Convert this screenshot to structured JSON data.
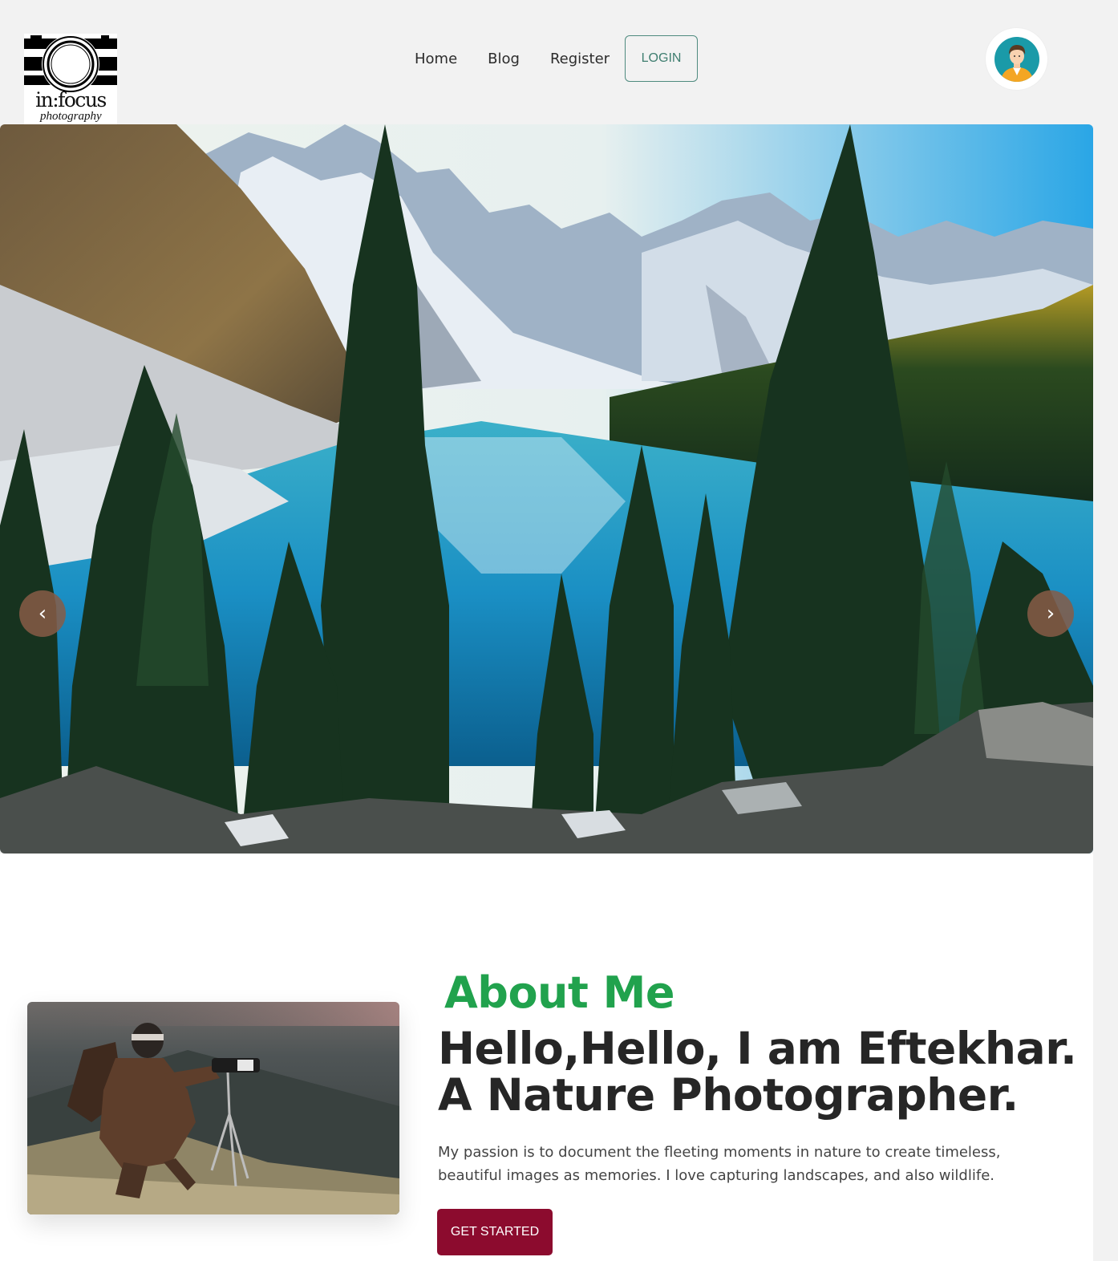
{
  "brand": {
    "name": "in:focus",
    "tagline": "photography"
  },
  "nav": {
    "items": [
      {
        "label": "Home"
      },
      {
        "label": "Blog"
      },
      {
        "label": "Register"
      }
    ],
    "login_label": "LOGIN"
  },
  "carousel": {
    "prev_glyph": "‹",
    "next_glyph": "›"
  },
  "about": {
    "label": "About Me",
    "heading": "Hello,Hello, I am Eftekhar. A Nature Photographer.",
    "text": "My passion is to document the fleeting moments in nature to create timeless, beautiful images as memories. I love capturing landscapes, and also wildlife.",
    "cta_label": "GET STARTED"
  },
  "icons": {
    "logo": "camera-lens-logo",
    "avatar": "user-avatar-icon",
    "prev": "chevron-left-icon",
    "next": "chevron-right-icon"
  },
  "colors": {
    "accent_green": "#21a24d",
    "login_border": "#4f8b7f",
    "cta_bg": "#8c0b2e",
    "page_bg": "#f2f2f2"
  }
}
